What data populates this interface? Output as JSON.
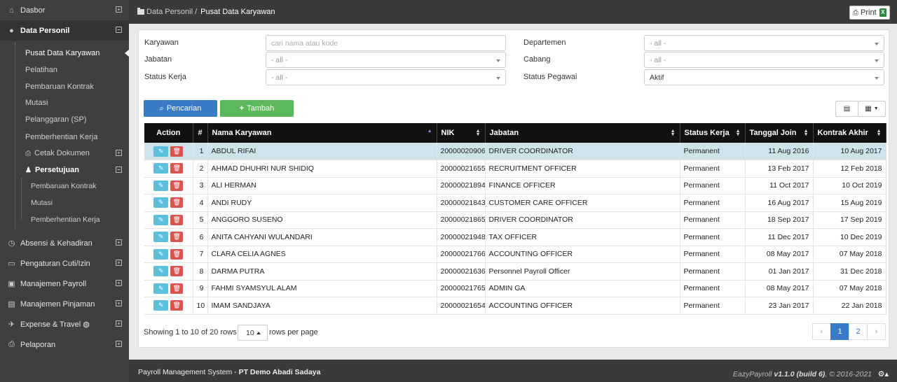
{
  "sidebar": {
    "items": [
      {
        "label": "Dasbor",
        "icon": "home-icon"
      },
      {
        "label": "Data Personil",
        "icon": "user-icon"
      },
      {
        "label": "Absensi & Kehadiran",
        "icon": "clock-icon"
      },
      {
        "label": "Pengaturan Cuti/Izin",
        "icon": "toggle-icon"
      },
      {
        "label": "Manajemen Payroll",
        "icon": "money-icon"
      },
      {
        "label": "Manajemen Pinjaman",
        "icon": "book-icon"
      },
      {
        "label": "Expense & Travel",
        "icon": "plane-icon"
      },
      {
        "label": "Pelaporan",
        "icon": "print-icon"
      }
    ],
    "sub": [
      "Pusat Data Karyawan",
      "Pelatihan",
      "Pembaruan Kontrak",
      "Mutasi",
      "Pelanggaran (SP)",
      "Pemberhentian Kerja",
      "Cetak Dokumen",
      "Persetujuan"
    ],
    "subsub": [
      "Pembaruan Kontrak",
      "Mutasi",
      "Pemberhentian Kerja"
    ]
  },
  "header": {
    "breadcrumb_parent": "Data Personil /",
    "breadcrumb_current": "Pusat Data Karyawan",
    "print_label": "Print"
  },
  "filters": {
    "karyawan_label": "Karyawan",
    "karyawan_placeholder": "cari nama atau kode",
    "jabatan_label": "Jabatan",
    "jabatan_value": "- all -",
    "status_kerja_label": "Status Kerja",
    "status_kerja_value": "- all -",
    "departemen_label": "Departemen",
    "departemen_value": "- all -",
    "cabang_label": "Cabang",
    "cabang_value": "- all -",
    "status_pegawai_label": "Status Pegawai",
    "status_pegawai_value": "Aktif"
  },
  "buttons": {
    "search": "Pencarian",
    "add": "Tambah"
  },
  "table": {
    "headers": [
      "Action",
      "#",
      "Nama Karyawan",
      "NIK",
      "Jabatan",
      "Status Kerja",
      "Tanggal Join",
      "Kontrak Akhir"
    ],
    "rows": [
      [
        "1",
        "ABDUL RIFAI",
        "20000020906",
        "DRIVER COORDINATOR",
        "Permanent",
        "11 Aug 2016",
        "10 Aug 2017"
      ],
      [
        "2",
        "AHMAD DHUHRI NUR SHIDIQ",
        "20000021655",
        "RECRUITMENT OFFICER",
        "Permanent",
        "13 Feb 2017",
        "12 Feb 2018"
      ],
      [
        "3",
        "ALI HERMAN",
        "20000021894",
        "FINANCE OFFICER",
        "Permanent",
        "11 Oct 2017",
        "10 Oct 2019"
      ],
      [
        "4",
        "ANDI RUDY",
        "20000021843",
        "CUSTOMER CARE OFFICER",
        "Permanent",
        "16 Aug 2017",
        "15 Aug 2019"
      ],
      [
        "5",
        "ANGGORO SUSENO",
        "20000021865",
        "DRIVER COORDINATOR",
        "Permanent",
        "18 Sep 2017",
        "17 Sep 2019"
      ],
      [
        "6",
        "ANITA CAHYANI WULANDARI",
        "20000021948",
        "TAX OFFICER",
        "Permanent",
        "11 Dec 2017",
        "10 Dec 2019"
      ],
      [
        "7",
        "CLARA CELIA AGNES",
        "20000021766",
        "ACCOUNTING OFFICER",
        "Permanent",
        "08 May 2017",
        "07 May 2018"
      ],
      [
        "8",
        "DARMA PUTRA",
        "20000021636",
        "Personnel Payroll Officer",
        "Permanent",
        "01 Jan 2017",
        "31 Dec 2018"
      ],
      [
        "9",
        "FAHMI SYAMSYUL ALAM",
        "20000021765",
        "ADMIN GA",
        "Permanent",
        "08 May 2017",
        "07 May 2018"
      ],
      [
        "10",
        "IMAM SANDJAYA",
        "20000021654",
        "ACCOUNTING OFFICER",
        "Permanent",
        "23 Jan 2017",
        "22 Jan 2018"
      ]
    ]
  },
  "pagination": {
    "showing": "Showing 1 to 10 of 20 rows",
    "page_size": "10",
    "per_page_label": "rows per page",
    "prev": "‹",
    "pages": [
      "1",
      "2"
    ],
    "next": "›"
  },
  "footer": {
    "system": "Payroll Management System - ",
    "company": "PT Demo Abadi Sadaya",
    "brand": "EazyPayroll ",
    "version": "v1.1.0 (build 6)",
    "copyright": ", © 2016-2021"
  },
  "colors": {
    "primary": "#3a7bc8",
    "success": "#5cb85c",
    "danger": "#d9534f",
    "info": "#5bc0de",
    "sidebar": "#3f3f3f",
    "table_header": "#111111"
  }
}
